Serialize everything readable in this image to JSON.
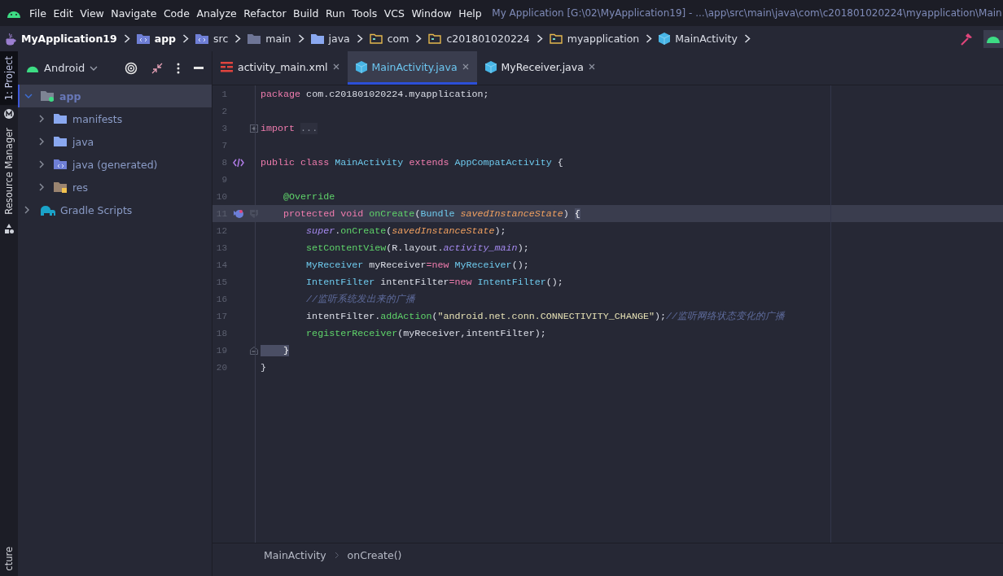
{
  "menu": [
    "File",
    "Edit",
    "View",
    "Navigate",
    "Code",
    "Analyze",
    "Refactor",
    "Build",
    "Run",
    "Tools",
    "VCS",
    "Window",
    "Help"
  ],
  "window": {
    "title": "My Application [G:\\02\\MyApplication19] - ...\\app\\src\\main\\java\\com\\c201801020224\\myapplication\\Main"
  },
  "navbar": [
    {
      "label": "MyApplication19",
      "kind": "project",
      "bold": true
    },
    {
      "label": "app",
      "kind": "module",
      "bold": true
    },
    {
      "label": "src",
      "kind": "module",
      "bold": false
    },
    {
      "label": "main",
      "kind": "folder_gray",
      "bold": false
    },
    {
      "label": "java",
      "kind": "folder_blue",
      "bold": false
    },
    {
      "label": "com",
      "kind": "package",
      "bold": false
    },
    {
      "label": "c201801020224",
      "kind": "package",
      "bold": false
    },
    {
      "label": "myapplication",
      "kind": "package",
      "bold": false
    },
    {
      "label": "MainActivity",
      "kind": "class",
      "bold": false
    }
  ],
  "left_strip": {
    "top": [
      {
        "label": "1: Project",
        "selected": true
      },
      {
        "label": "Resource Manager",
        "selected": false
      }
    ],
    "bottom": [
      {
        "label": "cture",
        "selected": false
      }
    ]
  },
  "project_panel": {
    "view": "Android",
    "tree": [
      {
        "label": "app",
        "kind": "module",
        "expanded": true,
        "selected": true,
        "children": [
          {
            "label": "manifests",
            "kind": "folder",
            "expanded": false,
            "selected": false
          },
          {
            "label": "java",
            "kind": "folder",
            "expanded": false,
            "selected": false
          },
          {
            "label": "java (generated)",
            "kind": "folder_gen",
            "expanded": false,
            "selected": false
          },
          {
            "label": "res",
            "kind": "folder_res",
            "expanded": false,
            "selected": false
          }
        ]
      },
      {
        "label": "Gradle Scripts",
        "kind": "gradle",
        "expanded": false,
        "selected": false
      }
    ]
  },
  "tabs": [
    {
      "label": "activity_main.xml",
      "kind": "layout",
      "selected": false
    },
    {
      "label": "MainActivity.java",
      "kind": "class",
      "selected": true
    },
    {
      "label": "MyReceiver.java",
      "kind": "class",
      "selected": false
    }
  ],
  "code": [
    {
      "number": "1",
      "kind": "code",
      "current": false,
      "tokens": [
        {
          "kind": "kw",
          "text": "package"
        },
        {
          "kind": "plain",
          "text": " com.c201801020224.myapplication;"
        }
      ]
    },
    {
      "number": "2",
      "kind": "code",
      "current": false
    },
    {
      "number": "3",
      "kind": "fold_expand",
      "current": false,
      "tokens": [
        {
          "kind": "kw",
          "text": "import "
        },
        {
          "kind": "folded",
          "text": "..."
        }
      ]
    },
    {
      "number": "7",
      "kind": "code",
      "current": false
    },
    {
      "number": "8",
      "kind": "class_decl",
      "current": false,
      "tokens": [
        {
          "kind": "kw",
          "text": "public class "
        },
        {
          "kind": "cls",
          "text": "MainActivity "
        },
        {
          "kind": "kw",
          "text": "extends "
        },
        {
          "kind": "cls",
          "text": "AppCompatActivity"
        },
        {
          "kind": "plain",
          "text": " {"
        }
      ]
    },
    {
      "number": "9",
      "kind": "code",
      "current": false
    },
    {
      "number": "10",
      "kind": "code",
      "current": false,
      "tokens": [
        {
          "kind": "annot",
          "text": "    @Override"
        }
      ]
    },
    {
      "number": "11",
      "kind": "method_start",
      "current": true,
      "tokens": [
        {
          "kind": "kw",
          "text": "    protected void "
        },
        {
          "kind": "method",
          "text": "onCreate"
        },
        {
          "kind": "plain",
          "text": "("
        },
        {
          "kind": "cls",
          "text": "Bundle "
        },
        {
          "kind": "param",
          "text": "savedInstanceState"
        },
        {
          "kind": "plain",
          "text": ") "
        },
        {
          "kind": "brace",
          "text": "{"
        }
      ]
    },
    {
      "number": "12",
      "kind": "code",
      "current": false,
      "tokens": [
        {
          "kind": "super",
          "text": "        super"
        },
        {
          "kind": "plain",
          "text": "."
        },
        {
          "kind": "method",
          "text": "onCreate"
        },
        {
          "kind": "plain",
          "text": "("
        },
        {
          "kind": "param",
          "text": "savedInstanceState"
        },
        {
          "kind": "plain",
          "text": ");"
        }
      ]
    },
    {
      "number": "13",
      "kind": "code",
      "current": false,
      "tokens": [
        {
          "kind": "method",
          "text": "        setContentView"
        },
        {
          "kind": "plain",
          "text": "(R.layout."
        },
        {
          "kind": "field",
          "text": "activity_main"
        },
        {
          "kind": "plain",
          "text": ");"
        }
      ]
    },
    {
      "number": "14",
      "kind": "code",
      "current": false,
      "tokens": [
        {
          "kind": "cls",
          "text": "        MyReceiver"
        },
        {
          "kind": "plain",
          "text": " myReceiver"
        },
        {
          "kind": "kw",
          "text": "=new "
        },
        {
          "kind": "cls",
          "text": "MyReceiver"
        },
        {
          "kind": "plain",
          "text": "();"
        }
      ]
    },
    {
      "number": "15",
      "kind": "code",
      "current": false,
      "tokens": [
        {
          "kind": "cls",
          "text": "        IntentFilter"
        },
        {
          "kind": "plain",
          "text": " intentFilter"
        },
        {
          "kind": "kw",
          "text": "=new "
        },
        {
          "kind": "cls",
          "text": "IntentFilter"
        },
        {
          "kind": "plain",
          "text": "();"
        }
      ]
    },
    {
      "number": "16",
      "kind": "code",
      "current": false,
      "tokens": [
        {
          "kind": "comment",
          "text": "        //监听系统发出来的广播"
        }
      ]
    },
    {
      "number": "17",
      "kind": "code",
      "current": false,
      "tokens": [
        {
          "kind": "plain",
          "text": "        intentFilter."
        },
        {
          "kind": "method",
          "text": "addAction"
        },
        {
          "kind": "plain",
          "text": "("
        },
        {
          "kind": "string",
          "text": "\"android.net.conn.CONNECTIVITY_CHANGE\""
        },
        {
          "kind": "plain",
          "text": ");"
        },
        {
          "kind": "comment",
          "text": "//监听网络状态变化的广播"
        }
      ]
    },
    {
      "number": "18",
      "kind": "code",
      "current": false,
      "tokens": [
        {
          "kind": "method",
          "text": "        registerReceiver"
        },
        {
          "kind": "plain",
          "text": "(myReceiver,intentFilter);"
        }
      ]
    },
    {
      "number": "19",
      "kind": "block_end",
      "current": false,
      "tokens": [
        {
          "kind": "brace",
          "text": "    }"
        }
      ]
    },
    {
      "number": "20",
      "kind": "code",
      "current": false,
      "tokens": [
        {
          "kind": "plain",
          "text": "}"
        }
      ]
    }
  ],
  "editor_breadcrumb": [
    "MainActivity",
    "onCreate()"
  ]
}
